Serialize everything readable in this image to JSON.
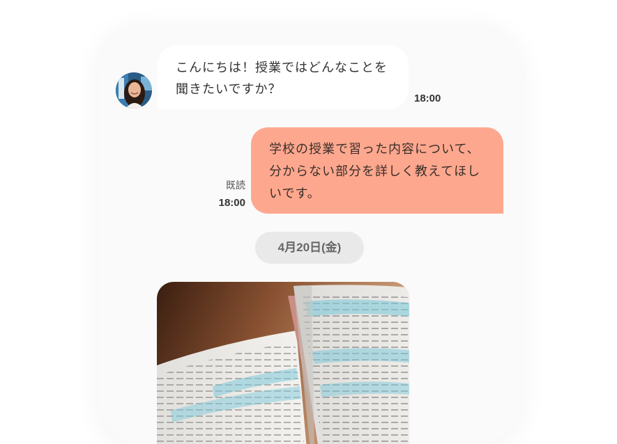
{
  "chat": {
    "incoming": {
      "line1": "こんにちは！授業ではどんなことを",
      "line2": "聞きたいですか？",
      "time": "18:00",
      "avatar": "user-avatar"
    },
    "outgoing": {
      "line1": "学校の授業で習った内容について、",
      "line2": "分からない部分を詳しく教えてほし",
      "line3": "いです。",
      "read_status": "既読",
      "time": "18:00"
    },
    "date_separator": "4月20日(金)",
    "image_message": {
      "description_icon": "open-book-photo"
    }
  },
  "colors": {
    "outgoing_bubble": "#fda88e",
    "incoming_bubble": "#ffffff",
    "screen_background": "#fafafa",
    "date_pill": "#e9e9e9"
  }
}
